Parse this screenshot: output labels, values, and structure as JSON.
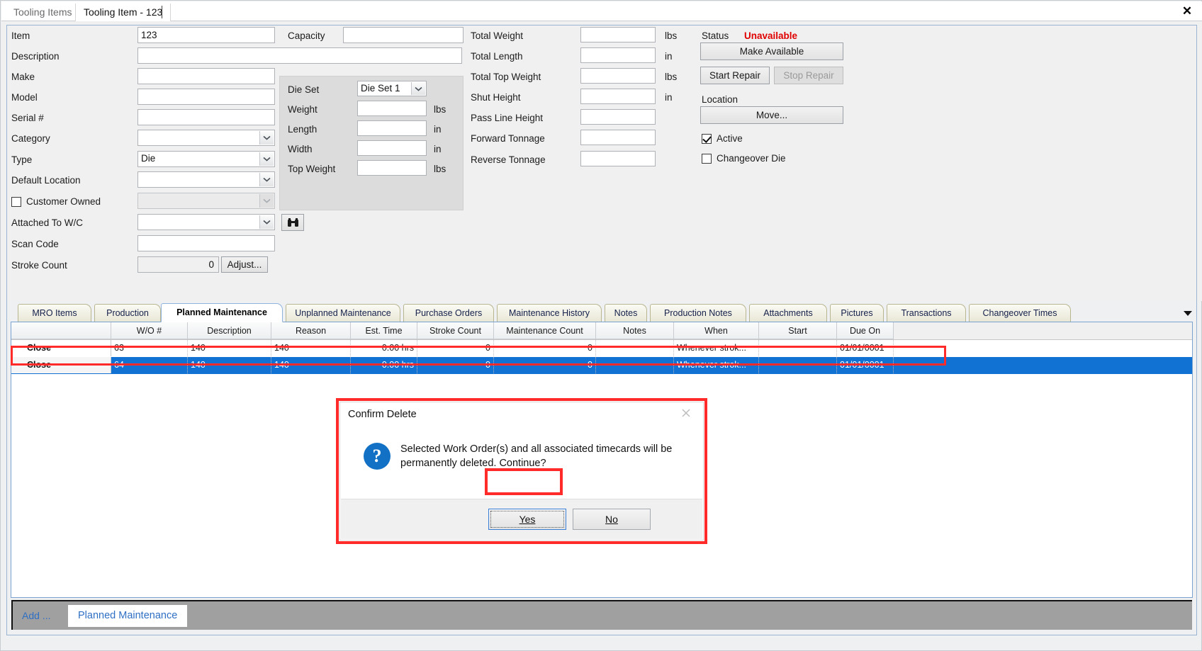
{
  "window": {
    "close_label": "✕",
    "doc_tabs": [
      {
        "label": "Tooling Items",
        "active": false
      },
      {
        "label": "Tooling Item - 123",
        "active": true
      }
    ]
  },
  "form": {
    "left_fields": [
      {
        "label": "Item",
        "value": "123",
        "kind": "text"
      },
      {
        "label": "Description",
        "value": "",
        "kind": "text-wide"
      },
      {
        "label": "Make",
        "value": "",
        "kind": "text"
      },
      {
        "label": "Model",
        "value": "",
        "kind": "text"
      },
      {
        "label": "Serial #",
        "value": "",
        "kind": "text"
      },
      {
        "label": "Category",
        "value": "",
        "kind": "combo"
      },
      {
        "label": "Type",
        "value": "Die",
        "kind": "combo"
      },
      {
        "label": "Default Location",
        "value": "",
        "kind": "combo"
      }
    ],
    "customer_owned": {
      "label": "Customer Owned",
      "checked": false,
      "value": ""
    },
    "attached_to_wc": {
      "label": "Attached To W/C",
      "value": ""
    },
    "scan_code": {
      "label": "Scan Code",
      "value": ""
    },
    "stroke_count": {
      "label": "Stroke Count",
      "value": "0",
      "adjust_label": "Adjust..."
    },
    "capacity": {
      "label": "Capacity",
      "value": ""
    },
    "die_set_group": {
      "fields": [
        {
          "label": "Die Set",
          "value": "Die Set 1",
          "unit": "",
          "kind": "combo"
        },
        {
          "label": "Weight",
          "value": "",
          "unit": "lbs",
          "kind": "text"
        },
        {
          "label": "Length",
          "value": "",
          "unit": "in",
          "kind": "text"
        },
        {
          "label": "Width",
          "value": "",
          "unit": "in",
          "kind": "text"
        },
        {
          "label": "Top Weight",
          "value": "",
          "unit": "lbs",
          "kind": "text"
        }
      ]
    },
    "measures": [
      {
        "label": "Total Weight",
        "value": "",
        "unit": "lbs"
      },
      {
        "label": "Total Length",
        "value": "",
        "unit": "in"
      },
      {
        "label": "Total Top Weight",
        "value": "",
        "unit": "lbs"
      },
      {
        "label": "Shut Height",
        "value": "",
        "unit": "in"
      },
      {
        "label": "Pass Line Height",
        "value": "",
        "unit": ""
      },
      {
        "label": "Forward Tonnage",
        "value": "",
        "unit": ""
      },
      {
        "label": "Reverse Tonnage",
        "value": "",
        "unit": ""
      }
    ],
    "status": {
      "label": "Status",
      "value": "Unavailable",
      "color": "#e00000",
      "make_available_label": "Make Available",
      "start_repair_label": "Start Repair",
      "stop_repair_label": "Stop Repair",
      "location_label": "Location",
      "move_label": "Move...",
      "active": {
        "label": "Active",
        "checked": true
      },
      "changeover_die": {
        "label": "Changeover Die",
        "checked": false
      }
    },
    "lookup_icon": "binoculars-icon"
  },
  "lower_tabs": [
    {
      "label": "MRO Items",
      "active": false
    },
    {
      "label": "Production",
      "active": false
    },
    {
      "label": "Planned Maintenance",
      "active": true
    },
    {
      "label": "Unplanned Maintenance",
      "active": false
    },
    {
      "label": "Purchase Orders",
      "active": false
    },
    {
      "label": "Maintenance History",
      "active": false
    },
    {
      "label": "Notes",
      "active": false
    },
    {
      "label": "Production Notes",
      "active": false
    },
    {
      "label": "Attachments",
      "active": false
    },
    {
      "label": "Pictures",
      "active": false
    },
    {
      "label": "Transactions",
      "active": false
    },
    {
      "label": "Changeover Times",
      "active": false
    }
  ],
  "grid": {
    "columns": [
      "",
      "W/O #",
      "Description",
      "Reason",
      "Est. Time",
      "Stroke Count",
      "Maintenance Count",
      "Notes",
      "When",
      "Start",
      "Due On"
    ],
    "rows": [
      {
        "action": "Close",
        "wo": "63",
        "description": "140",
        "reason": "140",
        "est_time": "0.00 hrs",
        "stroke_count": "0",
        "maintenance_count": "0",
        "notes": "",
        "when": "Whenever strok...",
        "start": "",
        "due_on": "01/01/0001",
        "selected": false
      },
      {
        "action": "Close",
        "wo": "64",
        "description": "140",
        "reason": "140",
        "est_time": "0.00 hrs",
        "stroke_count": "0",
        "maintenance_count": "0",
        "notes": "",
        "when": "Whenever strok...",
        "start": "",
        "due_on": "01/01/0001",
        "selected": true
      }
    ]
  },
  "dialog": {
    "title": "Confirm Delete",
    "close_label": "✕",
    "icon": "question-icon",
    "message": "Selected Work Order(s) and all associated timecards will be permanently deleted. Continue?",
    "yes_label": "Yes",
    "no_label": "No"
  },
  "bottom_bar": {
    "add_label": "Add ...",
    "chip_label": "Planned Maintenance"
  }
}
